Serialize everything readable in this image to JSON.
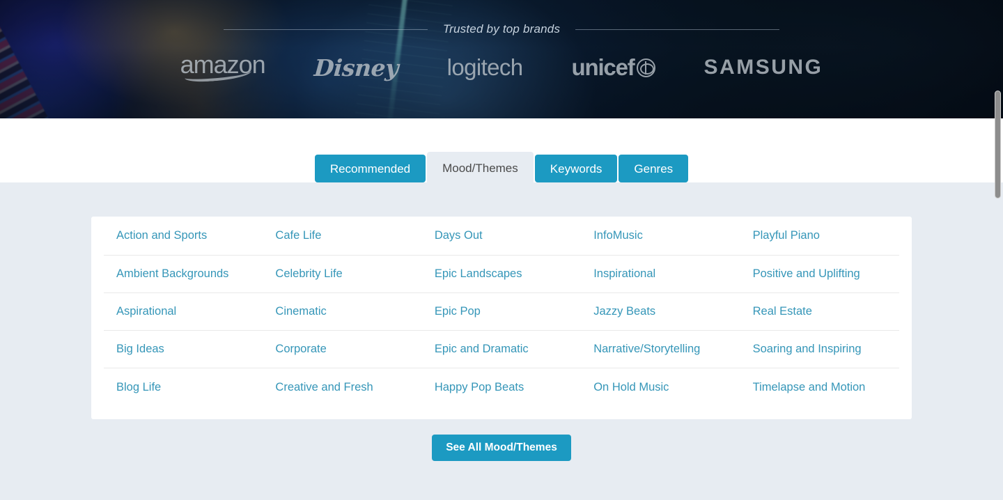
{
  "hero": {
    "trust_label": "Trusted by top brands",
    "brands": [
      {
        "name": "amazon",
        "icon": "amazon-logo"
      },
      {
        "name": "Disney",
        "icon": "disney-logo"
      },
      {
        "name": "logitech",
        "icon": "logitech-logo"
      },
      {
        "name": "unicef",
        "icon": "unicef-logo"
      },
      {
        "name": "SAMSUNG",
        "icon": "samsung-logo"
      }
    ]
  },
  "tabs": [
    {
      "label": "Recommended",
      "active": false
    },
    {
      "label": "Mood/Themes",
      "active": true
    },
    {
      "label": "Keywords",
      "active": false
    },
    {
      "label": "Genres",
      "active": false
    }
  ],
  "columns": [
    {
      "items": [
        "Action and Sports",
        "Ambient Backgrounds",
        "Aspirational",
        "Big Ideas",
        "Blog Life"
      ]
    },
    {
      "items": [
        "Cafe Life",
        "Celebrity Life",
        "Cinematic",
        "Corporate",
        "Creative and Fresh"
      ]
    },
    {
      "items": [
        "Days Out",
        "Epic Landscapes",
        "Epic Pop",
        "Epic and Dramatic",
        "Happy Pop Beats"
      ]
    },
    {
      "items": [
        "InfoMusic",
        "Inspirational",
        "Jazzy Beats",
        "Narrative/Storytelling",
        "On Hold Music"
      ]
    },
    {
      "items": [
        "Playful Piano",
        "Positive and Uplifting",
        "Real Estate",
        "Soaring and Inspiring",
        "Timelapse and Motion"
      ]
    }
  ],
  "see_all": {
    "label": "See All Mood/Themes"
  },
  "colors": {
    "accent": "#1c9ac2",
    "link": "#3596b8",
    "content_bg": "#e7ecf2",
    "card_bg": "#ffffff",
    "tab_active_text": "#4a4a4a",
    "hero_bg": "#0a1c30"
  }
}
